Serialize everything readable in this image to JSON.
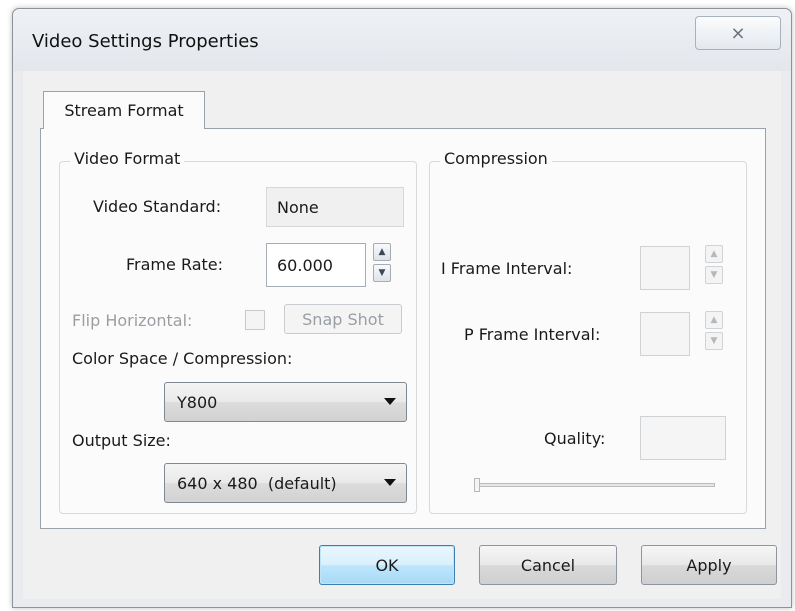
{
  "window": {
    "title": "Video Settings Properties",
    "close_glyph": "⨯"
  },
  "tabs": [
    {
      "label": "Stream Format"
    }
  ],
  "video_format": {
    "group_title": "Video Format",
    "video_standard_label": "Video Standard:",
    "video_standard_value": "None",
    "frame_rate_label": "Frame Rate:",
    "frame_rate_value": "60.000",
    "flip_horizontal_label": "Flip Horizontal:",
    "snap_shot_label": "Snap Shot",
    "color_space_label": "Color Space / Compression:",
    "color_space_value": "Y800",
    "output_size_label": "Output Size:",
    "output_size_value": "640 x 480  (default)"
  },
  "compression": {
    "group_title": "Compression",
    "i_frame_label": "I Frame Interval:",
    "i_frame_value": "",
    "p_frame_label": "P Frame Interval:",
    "p_frame_value": "",
    "quality_label": "Quality:",
    "quality_value": ""
  },
  "buttons": {
    "ok": "OK",
    "cancel": "Cancel",
    "apply": "Apply"
  },
  "icons": {
    "spin_up": "▲",
    "spin_down": "▼"
  }
}
